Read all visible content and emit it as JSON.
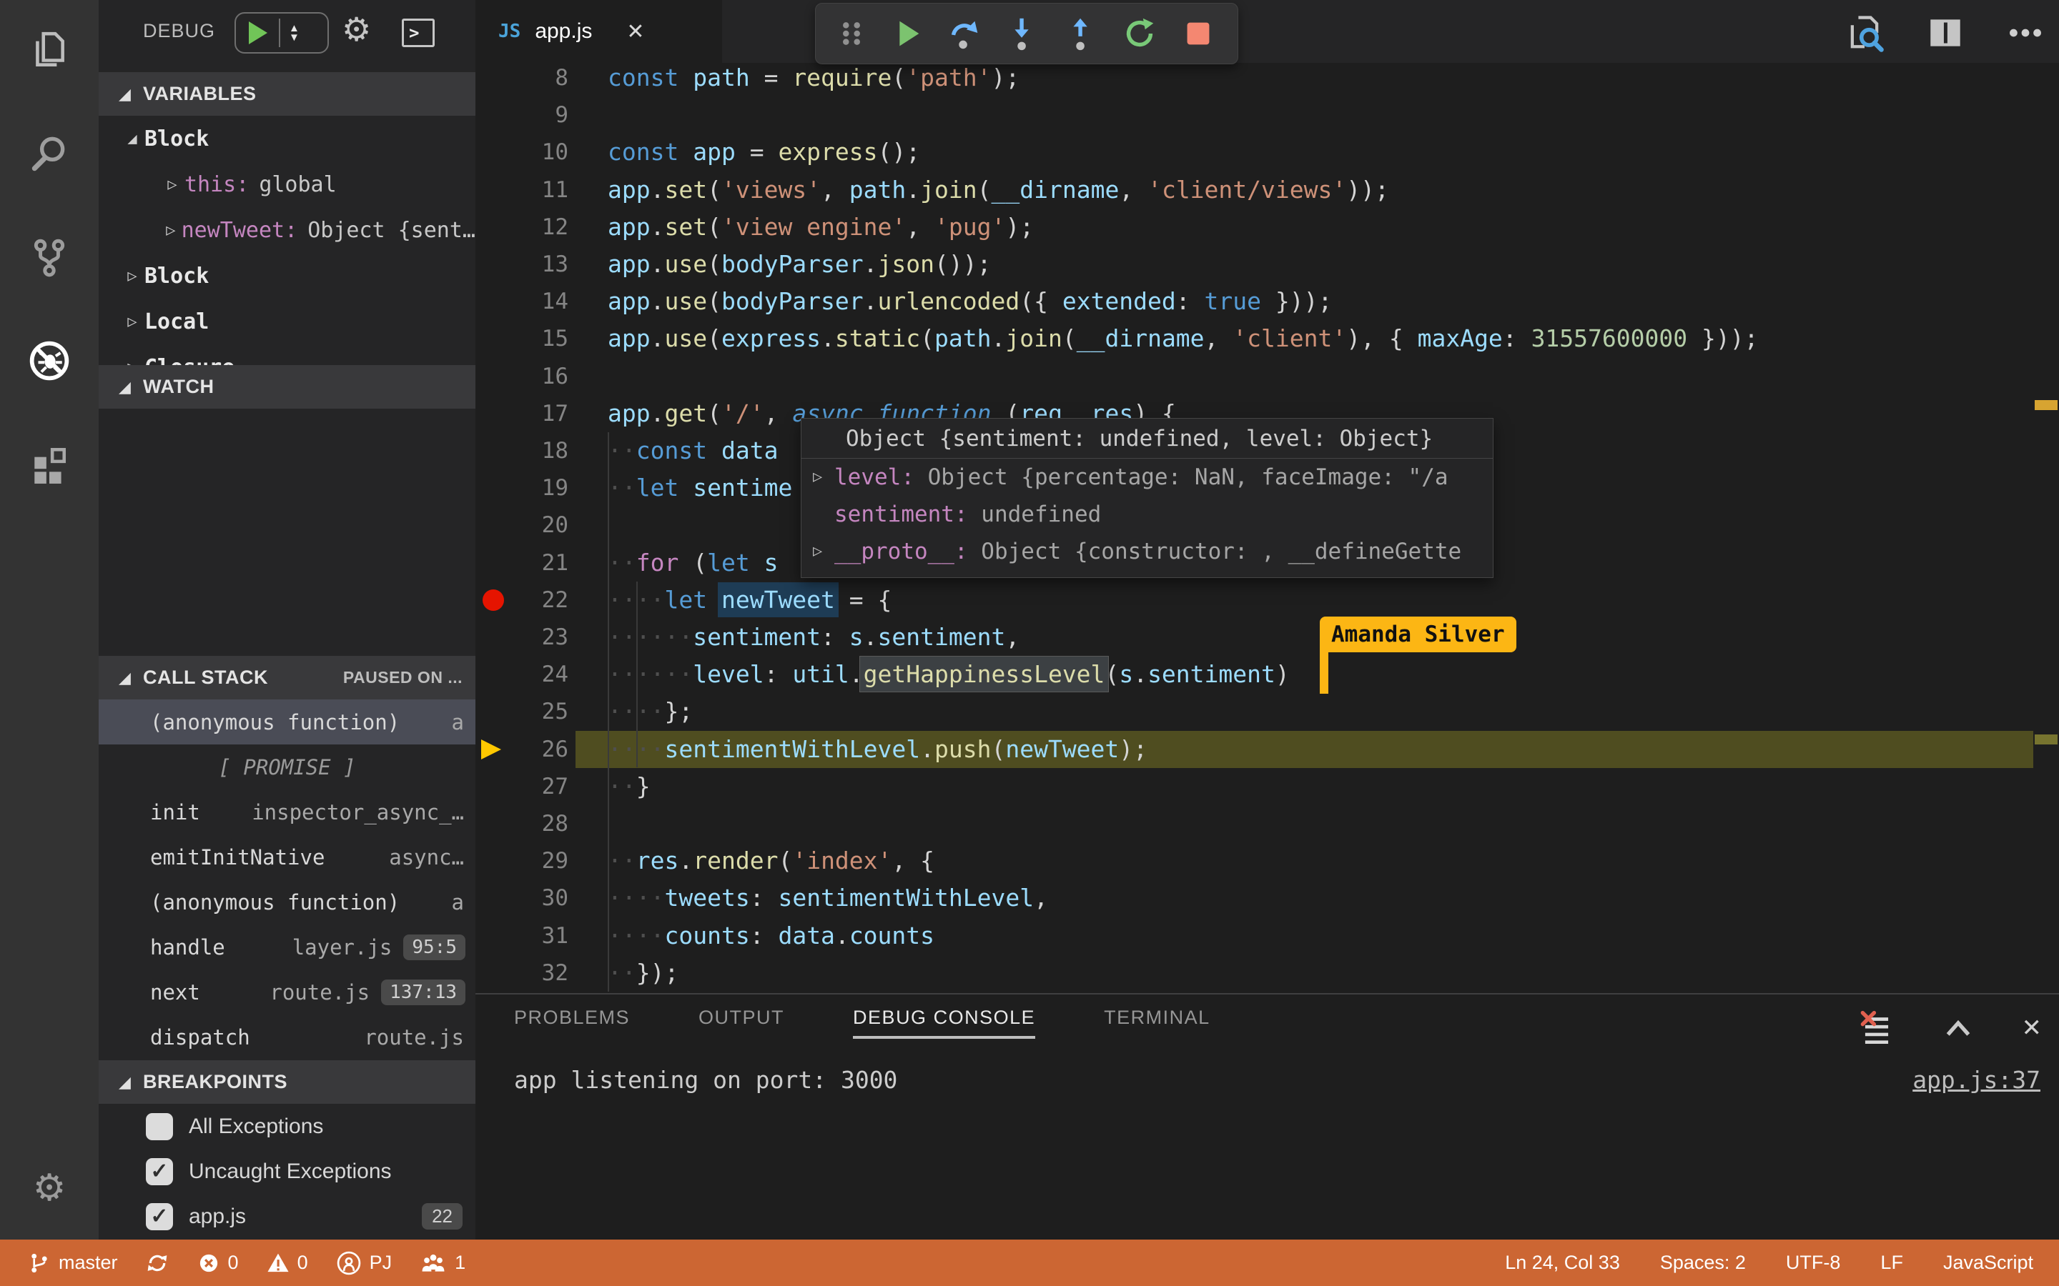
{
  "colors": {
    "status_bar": "#cc6633",
    "editor_bg": "#1e1e1e",
    "sidebar_bg": "#252526",
    "activity_bar_bg": "#333333",
    "breakpoint_red": "#e51400",
    "current_line": "#4f4d20",
    "collab_flag": "#fcb614",
    "keyword_blue": "#569cd6",
    "string_orange": "#ce9178",
    "function_yellow": "#dcdcaa",
    "variable_blue": "#9cdcfe",
    "number_green": "#b5cea8"
  },
  "activity_bar": {
    "icons": [
      "explorer-icon",
      "search-icon",
      "source-control-icon",
      "debug-icon",
      "extensions-icon",
      "settings-gear-icon"
    ]
  },
  "sidebar": {
    "title": "DEBUG",
    "variables": {
      "header": "VARIABLES",
      "items": [
        {
          "kind": "scope",
          "label": "Block",
          "expanded": true
        },
        {
          "kind": "child",
          "name": "this:",
          "value": "global"
        },
        {
          "kind": "child",
          "name": "newTweet:",
          "value": "Object {sent…"
        },
        {
          "kind": "scope",
          "label": "Block",
          "expanded": false
        },
        {
          "kind": "scope",
          "label": "Local",
          "expanded": false
        },
        {
          "kind": "scope",
          "label": "Closure",
          "expanded": false
        }
      ]
    },
    "watch": {
      "header": "WATCH"
    },
    "call_stack": {
      "header": "CALL STACK",
      "note": "PAUSED ON ...",
      "frames": [
        {
          "name": "(anonymous function)",
          "file": "a",
          "selected": true
        },
        {
          "name": "[ PROMISE ]",
          "label_row": true
        },
        {
          "name": "init",
          "file": "inspector_async_…"
        },
        {
          "name": "emitInitNative",
          "file": "async…"
        },
        {
          "name": "(anonymous function)",
          "file": "a"
        },
        {
          "name": "handle",
          "file": "layer.js",
          "badge": "95:5"
        },
        {
          "name": "next",
          "file": "route.js",
          "badge": "137:13"
        },
        {
          "name": "dispatch",
          "file": "route.js"
        }
      ]
    },
    "breakpoints": {
      "header": "BREAKPOINTS",
      "items": [
        {
          "label": "All Exceptions",
          "checked": false
        },
        {
          "label": "Uncaught Exceptions",
          "checked": true
        },
        {
          "label": "app.js",
          "checked": true,
          "badge": "22"
        }
      ]
    }
  },
  "editor": {
    "tab": {
      "icon": "JS",
      "label": "app.js",
      "close": "✕"
    },
    "lines": [
      {
        "n": 8,
        "seg": [
          [
            "k",
            "const "
          ],
          [
            "v",
            "path"
          ],
          [
            "p",
            " = "
          ],
          [
            "f",
            "require"
          ],
          [
            "p",
            "("
          ],
          [
            "s",
            "'path'"
          ],
          [
            "p",
            ");"
          ]
        ]
      },
      {
        "n": 9,
        "seg": []
      },
      {
        "n": 10,
        "seg": [
          [
            "k",
            "const "
          ],
          [
            "v",
            "app"
          ],
          [
            "p",
            " = "
          ],
          [
            "f",
            "express"
          ],
          [
            "p",
            "();"
          ]
        ]
      },
      {
        "n": 11,
        "seg": [
          [
            "v",
            "app"
          ],
          [
            "p",
            "."
          ],
          [
            "f",
            "set"
          ],
          [
            "p",
            "("
          ],
          [
            "s",
            "'views'"
          ],
          [
            "p",
            ", "
          ],
          [
            "v",
            "path"
          ],
          [
            "p",
            "."
          ],
          [
            "f",
            "join"
          ],
          [
            "p",
            "("
          ],
          [
            "v",
            "__dirname"
          ],
          [
            "p",
            ", "
          ],
          [
            "s",
            "'client/views'"
          ],
          [
            "p",
            "));"
          ]
        ]
      },
      {
        "n": 12,
        "seg": [
          [
            "v",
            "app"
          ],
          [
            "p",
            "."
          ],
          [
            "f",
            "set"
          ],
          [
            "p",
            "("
          ],
          [
            "s",
            "'view engine'"
          ],
          [
            "p",
            ", "
          ],
          [
            "s",
            "'pug'"
          ],
          [
            "p",
            ");"
          ]
        ]
      },
      {
        "n": 13,
        "seg": [
          [
            "v",
            "app"
          ],
          [
            "p",
            "."
          ],
          [
            "f",
            "use"
          ],
          [
            "p",
            "("
          ],
          [
            "v",
            "bodyParser"
          ],
          [
            "p",
            "."
          ],
          [
            "f",
            "json"
          ],
          [
            "p",
            "());"
          ]
        ]
      },
      {
        "n": 14,
        "seg": [
          [
            "v",
            "app"
          ],
          [
            "p",
            "."
          ],
          [
            "f",
            "use"
          ],
          [
            "p",
            "("
          ],
          [
            "v",
            "bodyParser"
          ],
          [
            "p",
            "."
          ],
          [
            "f",
            "urlencoded"
          ],
          [
            "p",
            "({ "
          ],
          [
            "v",
            "extended"
          ],
          [
            "p",
            ": "
          ],
          [
            "k",
            "true"
          ],
          [
            "p",
            " }));"
          ]
        ]
      },
      {
        "n": 15,
        "seg": [
          [
            "v",
            "app"
          ],
          [
            "p",
            "."
          ],
          [
            "f",
            "use"
          ],
          [
            "p",
            "("
          ],
          [
            "v",
            "express"
          ],
          [
            "p",
            "."
          ],
          [
            "f",
            "static"
          ],
          [
            "p",
            "("
          ],
          [
            "v",
            "path"
          ],
          [
            "p",
            "."
          ],
          [
            "f",
            "join"
          ],
          [
            "p",
            "("
          ],
          [
            "v",
            "__dirname"
          ],
          [
            "p",
            ", "
          ],
          [
            "s",
            "'client'"
          ],
          [
            "p",
            "), { "
          ],
          [
            "v",
            "maxAge"
          ],
          [
            "p",
            ": "
          ],
          [
            "n",
            "31557600000"
          ],
          [
            "p",
            " }));"
          ]
        ]
      },
      {
        "n": 16,
        "seg": []
      },
      {
        "n": 17,
        "seg": [
          [
            "v",
            "app"
          ],
          [
            "p",
            "."
          ],
          [
            "f",
            "get"
          ],
          [
            "p",
            "("
          ],
          [
            "s",
            "'/'"
          ],
          [
            "p",
            ", "
          ],
          [
            "ki",
            "async "
          ],
          [
            "ki",
            "function "
          ],
          [
            "p",
            "("
          ],
          [
            "v",
            "req"
          ],
          [
            "p",
            ", "
          ],
          [
            "v",
            "res"
          ],
          [
            "p",
            ") {"
          ]
        ]
      },
      {
        "n": 18,
        "seg": [
          [
            "w",
            "··"
          ],
          [
            "k",
            "const "
          ],
          [
            "v",
            "data"
          ]
        ]
      },
      {
        "n": 19,
        "seg": [
          [
            "w",
            "··"
          ],
          [
            "k",
            "let "
          ],
          [
            "v",
            "sentime"
          ]
        ]
      },
      {
        "n": 20,
        "seg": []
      },
      {
        "n": 21,
        "seg": [
          [
            "w",
            "··"
          ],
          [
            "c",
            "for "
          ],
          [
            "p",
            "("
          ],
          [
            "k",
            "let "
          ],
          [
            "v",
            "s"
          ]
        ]
      },
      {
        "n": 22,
        "breakpoint": true,
        "seg": [
          [
            "w",
            "····"
          ],
          [
            "k",
            "let "
          ],
          [
            "vh",
            "newTweet"
          ],
          [
            "p",
            " = {"
          ]
        ]
      },
      {
        "n": 23,
        "seg": [
          [
            "w",
            "······"
          ],
          [
            "v",
            "sentiment"
          ],
          [
            "p",
            ": "
          ],
          [
            "v",
            "s"
          ],
          [
            "p",
            "."
          ],
          [
            "v",
            "sentiment"
          ],
          [
            "p",
            ","
          ]
        ]
      },
      {
        "n": 24,
        "seg": [
          [
            "w",
            "······"
          ],
          [
            "v",
            "level"
          ],
          [
            "p",
            ": "
          ],
          [
            "v",
            "util"
          ],
          [
            "p",
            "."
          ],
          [
            "fh",
            "getHappinessLevel"
          ],
          [
            "p",
            "("
          ],
          [
            "v",
            "s"
          ],
          [
            "p",
            "."
          ],
          [
            "v",
            "sentiment"
          ],
          [
            "p",
            ")"
          ]
        ]
      },
      {
        "n": 25,
        "seg": [
          [
            "w",
            "····"
          ],
          [
            "p",
            "};"
          ]
        ]
      },
      {
        "n": 26,
        "current": true,
        "seg": [
          [
            "w",
            "····"
          ],
          [
            "v",
            "sentimentWithLevel"
          ],
          [
            "p",
            "."
          ],
          [
            "f",
            "push"
          ],
          [
            "p",
            "("
          ],
          [
            "v",
            "newTweet"
          ],
          [
            "p",
            ");"
          ]
        ]
      },
      {
        "n": 27,
        "seg": [
          [
            "w",
            "··"
          ],
          [
            "p",
            "}"
          ]
        ]
      },
      {
        "n": 28,
        "seg": []
      },
      {
        "n": 29,
        "seg": [
          [
            "w",
            "··"
          ],
          [
            "v",
            "res"
          ],
          [
            "p",
            "."
          ],
          [
            "f",
            "render"
          ],
          [
            "p",
            "("
          ],
          [
            "s",
            "'index'"
          ],
          [
            "p",
            ", {"
          ]
        ]
      },
      {
        "n": 30,
        "seg": [
          [
            "w",
            "····"
          ],
          [
            "v",
            "tweets"
          ],
          [
            "p",
            ": "
          ],
          [
            "v",
            "sentimentWithLevel"
          ],
          [
            "p",
            ","
          ]
        ]
      },
      {
        "n": 31,
        "seg": [
          [
            "w",
            "····"
          ],
          [
            "v",
            "counts"
          ],
          [
            "p",
            ": "
          ],
          [
            "v",
            "data"
          ],
          [
            "p",
            "."
          ],
          [
            "v",
            "counts"
          ]
        ]
      },
      {
        "n": 32,
        "seg": [
          [
            "w",
            "··"
          ],
          [
            "p",
            "});"
          ]
        ]
      }
    ]
  },
  "debug_toolbar": {
    "buttons": [
      "drag-grip",
      "continue",
      "step-over",
      "step-into",
      "step-out",
      "restart",
      "stop"
    ]
  },
  "tooltip": {
    "header": "Object {sentiment: undefined, level: Object}",
    "rows": [
      {
        "twisty": true,
        "name": "level:",
        "value": " Object {percentage: NaN, faceImage: \"/a"
      },
      {
        "twisty": false,
        "name": "sentiment:",
        "value": " undefined"
      },
      {
        "twisty": true,
        "name": "__proto__:",
        "value": " Object {constructor: , __defineGette"
      }
    ]
  },
  "collab_cursor": {
    "name": "Amanda Silver"
  },
  "panel": {
    "tabs": [
      {
        "label": "PROBLEMS",
        "active": false
      },
      {
        "label": "OUTPUT",
        "active": false
      },
      {
        "label": "DEBUG CONSOLE",
        "active": true
      },
      {
        "label": "TERMINAL",
        "active": false
      }
    ],
    "console_line": "app listening on port: 3000",
    "source_link": "app.js:37",
    "close": "✕"
  },
  "status_bar": {
    "left": [
      {
        "icon": "git-branch-icon",
        "label": "master"
      },
      {
        "icon": "sync-icon",
        "label": ""
      },
      {
        "icon": "error-icon",
        "label": "0"
      },
      {
        "icon": "warning-icon",
        "label": "0"
      },
      {
        "icon": "live-share-icon",
        "label": "PJ"
      },
      {
        "icon": "participants-icon",
        "label": "1"
      }
    ],
    "right": [
      {
        "label": "Ln 24, Col 33"
      },
      {
        "label": "Spaces: 2"
      },
      {
        "label": "UTF-8"
      },
      {
        "label": "LF"
      },
      {
        "label": "JavaScript"
      }
    ]
  }
}
